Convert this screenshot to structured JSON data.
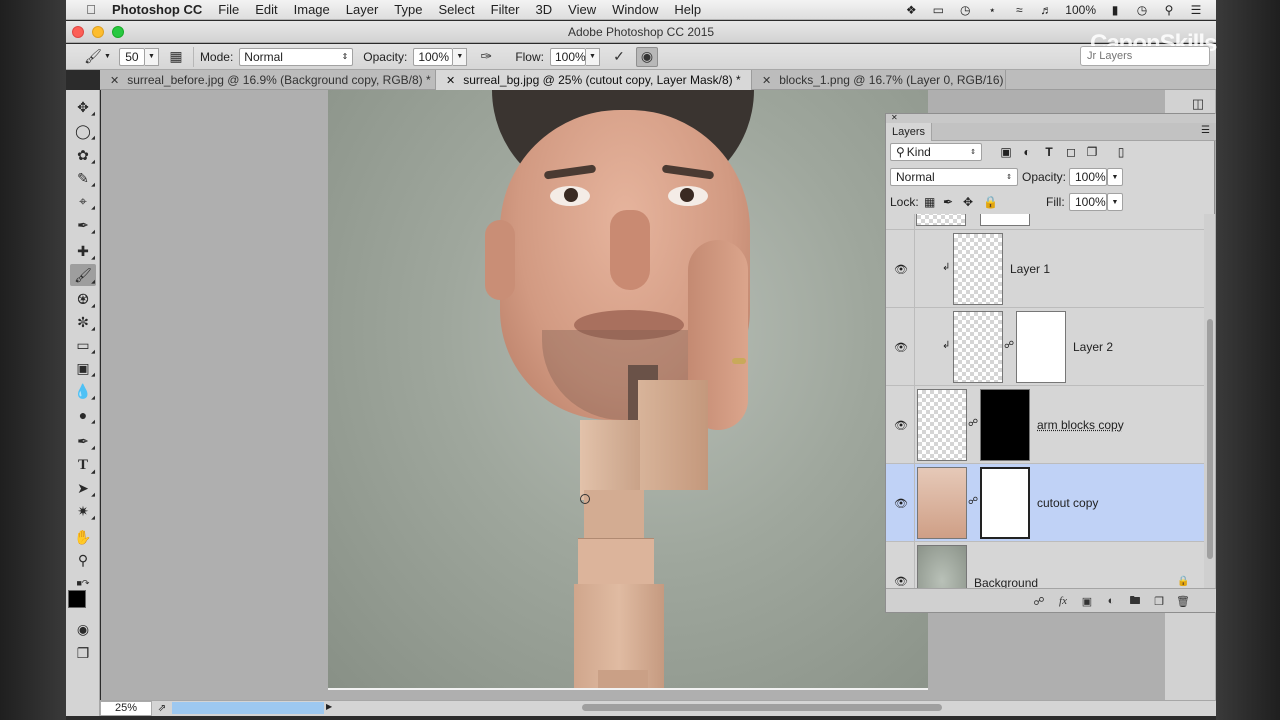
{
  "menubar": {
    "app_name": "Photoshop CC",
    "items": [
      "File",
      "Edit",
      "Image",
      "Layer",
      "Type",
      "Select",
      "Filter",
      "3D",
      "View",
      "Window",
      "Help"
    ],
    "battery": "100%"
  },
  "window": {
    "title": "Adobe Photoshop CC 2015"
  },
  "options": {
    "brush_size": "50",
    "mode_label": "Mode:",
    "mode_value": "Normal",
    "opacity_label": "Opacity:",
    "opacity_value": "100%",
    "flow_label": "Flow:",
    "flow_value": "100%"
  },
  "workspace_search": {
    "placeholder": "Jr Layers"
  },
  "watermark": "CanonSkills",
  "tabs": [
    {
      "label": "surreal_before.jpg @ 16.9% (Background copy, RGB/8) *",
      "active": false
    },
    {
      "label": "surreal_bg.jpg @ 25% (cutout copy, Layer Mask/8) *",
      "active": true
    },
    {
      "label": "blocks_1.png @ 16.7% (Layer 0, RGB/16)",
      "active": false
    }
  ],
  "status": {
    "zoom": "25%",
    "progress_fraction": 1.0
  },
  "layers_panel": {
    "tab": "Layers",
    "filter_kind": "Kind",
    "blend_mode": "Normal",
    "opacity_label": "Opacity:",
    "opacity_value": "100%",
    "lock_label": "Lock:",
    "fill_label": "Fill:",
    "fill_value": "100%",
    "layers": [
      {
        "name": "Layer 1"
      },
      {
        "name": "Layer 2"
      },
      {
        "name": "arm blocks copy"
      },
      {
        "name": "cutout copy"
      },
      {
        "name": "Background"
      }
    ]
  },
  "colors": {
    "selected_layer": "#c0d2f6",
    "progress_bar": "#9dc8f0"
  }
}
